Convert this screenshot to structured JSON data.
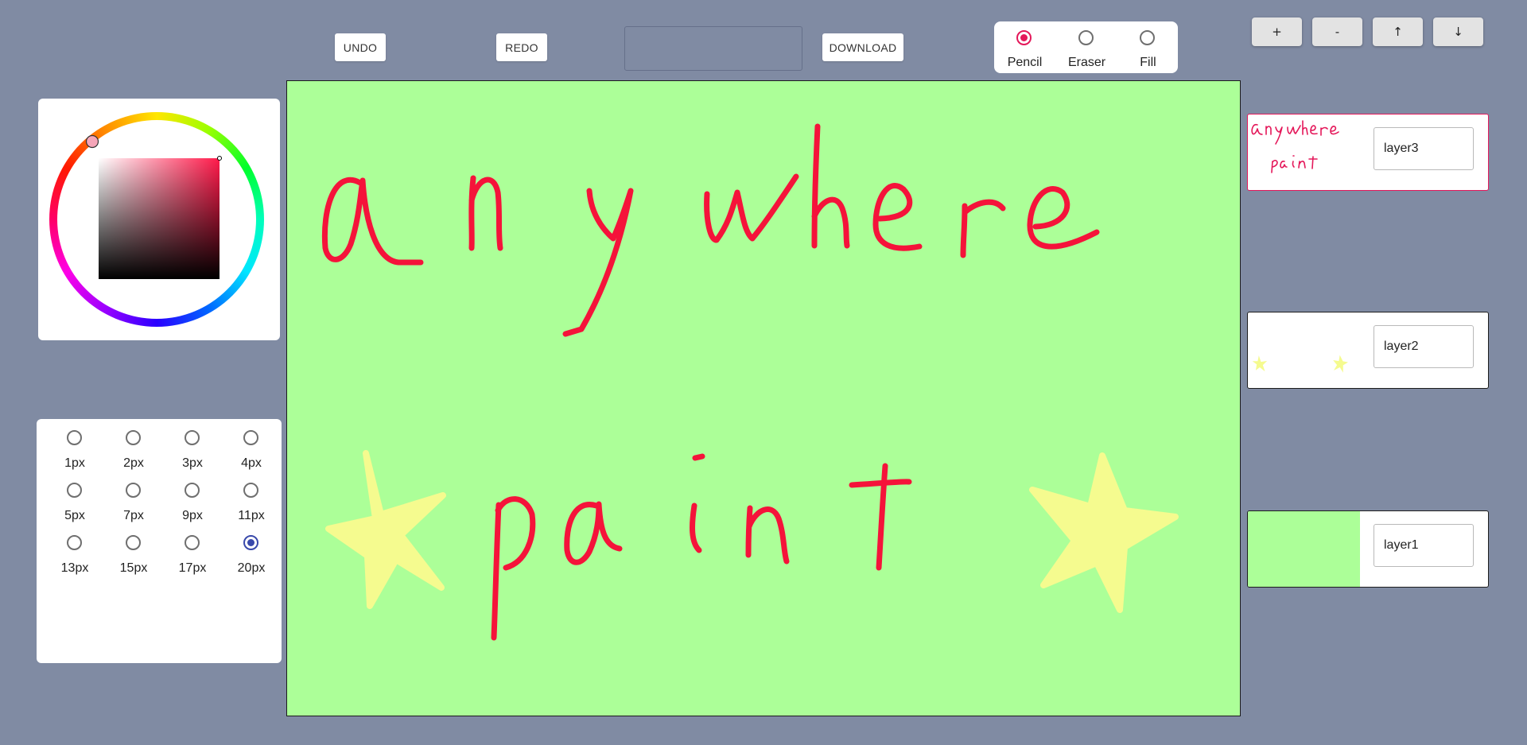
{
  "toolbar": {
    "undo_label": "UNDO",
    "redo_label": "REDO",
    "download_label": "DOWNLOAD"
  },
  "tools": {
    "selected": "Pencil",
    "options": [
      {
        "label": "Pencil",
        "checked": true
      },
      {
        "label": "Eraser",
        "checked": false
      },
      {
        "label": "Fill",
        "checked": false
      }
    ]
  },
  "layer_controls": {
    "add_label": "+",
    "remove_label": "-",
    "move_up_label": "↑",
    "move_down_label": "↓"
  },
  "color": {
    "selected_hex": "#e4185a",
    "canvas_background": "#acff98",
    "stroke_color": "#f5133a",
    "star_color": "#f5fb8f"
  },
  "brush_sizes": {
    "selected": "20px",
    "options": [
      "1px",
      "2px",
      "3px",
      "4px",
      "5px",
      "7px",
      "9px",
      "11px",
      "13px",
      "15px",
      "17px",
      "20px"
    ]
  },
  "layers": [
    {
      "name": "layer3",
      "active": true
    },
    {
      "name": "layer2",
      "active": false
    },
    {
      "name": "layer1",
      "active": false
    }
  ]
}
